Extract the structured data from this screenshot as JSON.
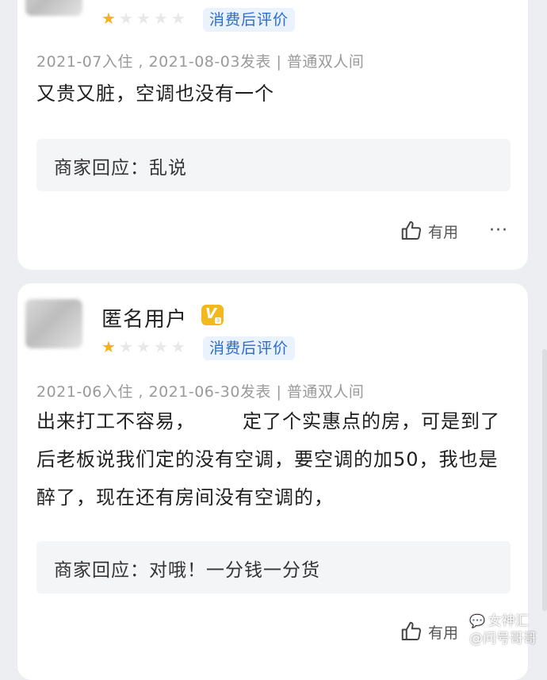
{
  "reviews": [
    {
      "rating": 1,
      "tag": "消费后评价",
      "meta": "2021-07入住 , 2021-08-03发表 | 普通双人间",
      "text": "又贵又脏，空调也没有一个",
      "reply": "商家回应：乱说",
      "useful_label": "有用",
      "more_label": "···"
    },
    {
      "user": "匿名用户",
      "level_badge": "V",
      "level_number": "3",
      "rating": 1,
      "tag": "消费后评价",
      "meta": "2021-06入住 , 2021-06-30发表 | 普通双人间",
      "text_part1": "出来打工不容易，",
      "text_part2": "定了个实惠点的房，可是到了后老板说我们定的没有空调，要空调的加50，我也是醉了，现在还有房间没有空调的，",
      "reply": "商家回应：对哦！一分钱一分货",
      "useful_label": "有用"
    }
  ],
  "watermark": {
    "line1": "女神汇",
    "line2": "@问号哥哥",
    "icon": "wechat-icon"
  },
  "colors": {
    "star_on": "#f5b21a",
    "star_off": "#e8e8e8",
    "tag_bg": "#eaf2fd",
    "tag_text": "#2c6bd1",
    "badge": "#f3b81d"
  }
}
